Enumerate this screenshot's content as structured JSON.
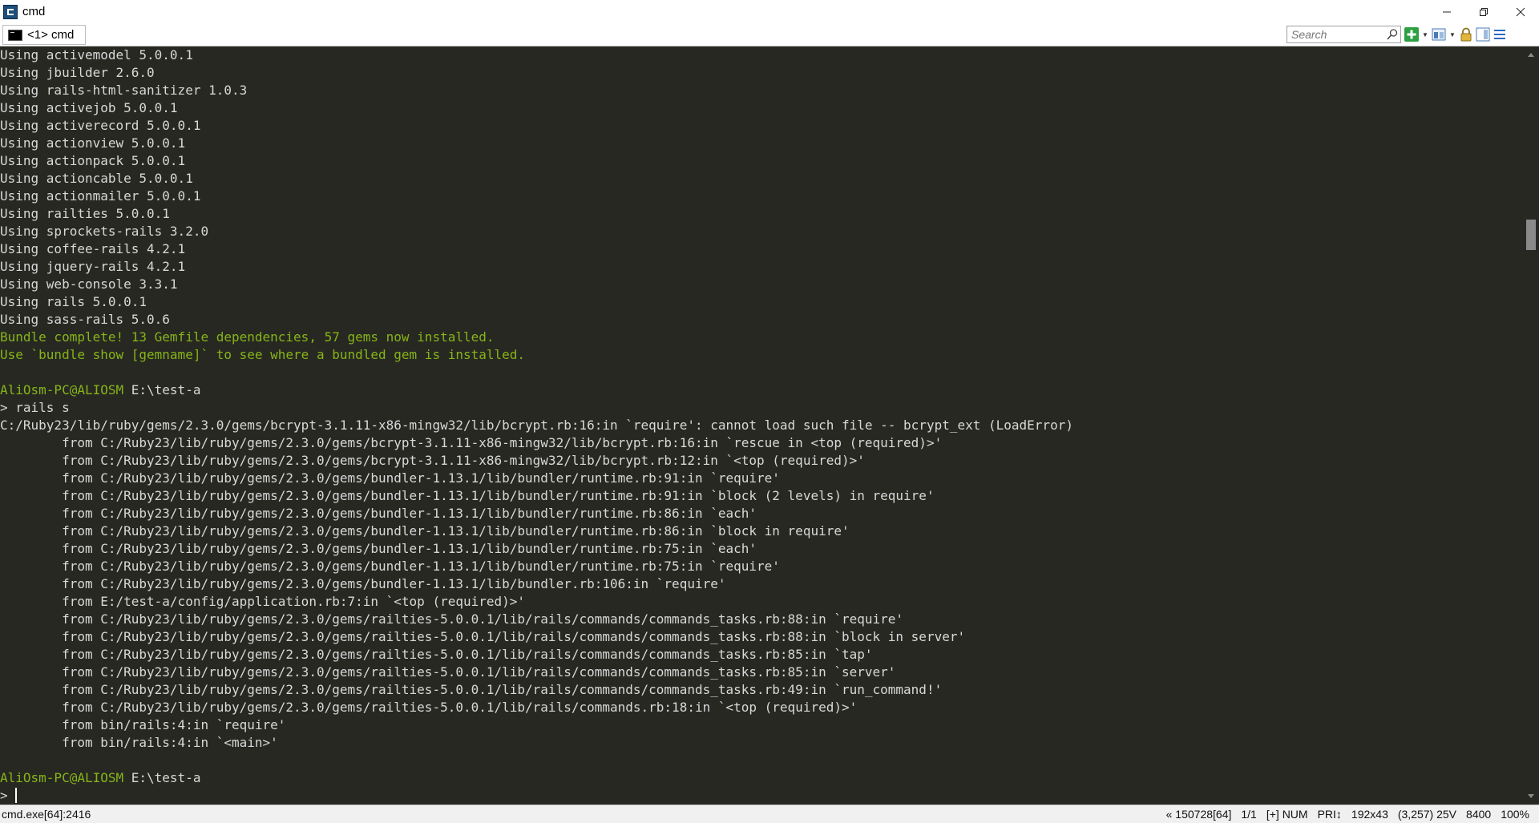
{
  "window": {
    "title": "cmd",
    "controls": {
      "minimize": "—",
      "restore": "❐",
      "close": "✕"
    }
  },
  "toolbar": {
    "tab_label": "<1> cmd",
    "search_placeholder": "Search"
  },
  "console": {
    "lines": [
      {
        "text": "Using activemodel 5.0.0.1",
        "style": "normal"
      },
      {
        "text": "Using jbuilder 2.6.0",
        "style": "normal"
      },
      {
        "text": "Using rails-html-sanitizer 1.0.3",
        "style": "normal"
      },
      {
        "text": "Using activejob 5.0.0.1",
        "style": "normal"
      },
      {
        "text": "Using activerecord 5.0.0.1",
        "style": "normal"
      },
      {
        "text": "Using actionview 5.0.0.1",
        "style": "normal"
      },
      {
        "text": "Using actionpack 5.0.0.1",
        "style": "normal"
      },
      {
        "text": "Using actioncable 5.0.0.1",
        "style": "normal"
      },
      {
        "text": "Using actionmailer 5.0.0.1",
        "style": "normal"
      },
      {
        "text": "Using railties 5.0.0.1",
        "style": "normal"
      },
      {
        "text": "Using sprockets-rails 3.2.0",
        "style": "normal"
      },
      {
        "text": "Using coffee-rails 4.2.1",
        "style": "normal"
      },
      {
        "text": "Using jquery-rails 4.2.1",
        "style": "normal"
      },
      {
        "text": "Using web-console 3.3.1",
        "style": "normal"
      },
      {
        "text": "Using rails 5.0.0.1",
        "style": "normal"
      },
      {
        "text": "Using sass-rails 5.0.6",
        "style": "normal"
      },
      {
        "text": "Bundle complete! 13 Gemfile dependencies, 57 gems now installed.",
        "style": "green"
      },
      {
        "text": "Use `bundle show [gemname]` to see where a bundled gem is installed.",
        "style": "green"
      },
      {
        "text": "",
        "style": "normal"
      },
      {
        "text": "AliOsm-PC@ALIOSM E:\\test-a",
        "style": "prompt"
      },
      {
        "text": "> rails s",
        "style": "normal"
      },
      {
        "text": "C:/Ruby23/lib/ruby/gems/2.3.0/gems/bcrypt-3.1.11-x86-mingw32/lib/bcrypt.rb:16:in `require': cannot load such file -- bcrypt_ext (LoadError)",
        "style": "normal"
      },
      {
        "text": "        from C:/Ruby23/lib/ruby/gems/2.3.0/gems/bcrypt-3.1.11-x86-mingw32/lib/bcrypt.rb:16:in `rescue in <top (required)>'",
        "style": "normal"
      },
      {
        "text": "        from C:/Ruby23/lib/ruby/gems/2.3.0/gems/bcrypt-3.1.11-x86-mingw32/lib/bcrypt.rb:12:in `<top (required)>'",
        "style": "normal"
      },
      {
        "text": "        from C:/Ruby23/lib/ruby/gems/2.3.0/gems/bundler-1.13.1/lib/bundler/runtime.rb:91:in `require'",
        "style": "normal"
      },
      {
        "text": "        from C:/Ruby23/lib/ruby/gems/2.3.0/gems/bundler-1.13.1/lib/bundler/runtime.rb:91:in `block (2 levels) in require'",
        "style": "normal"
      },
      {
        "text": "        from C:/Ruby23/lib/ruby/gems/2.3.0/gems/bundler-1.13.1/lib/bundler/runtime.rb:86:in `each'",
        "style": "normal"
      },
      {
        "text": "        from C:/Ruby23/lib/ruby/gems/2.3.0/gems/bundler-1.13.1/lib/bundler/runtime.rb:86:in `block in require'",
        "style": "normal"
      },
      {
        "text": "        from C:/Ruby23/lib/ruby/gems/2.3.0/gems/bundler-1.13.1/lib/bundler/runtime.rb:75:in `each'",
        "style": "normal"
      },
      {
        "text": "        from C:/Ruby23/lib/ruby/gems/2.3.0/gems/bundler-1.13.1/lib/bundler/runtime.rb:75:in `require'",
        "style": "normal"
      },
      {
        "text": "        from C:/Ruby23/lib/ruby/gems/2.3.0/gems/bundler-1.13.1/lib/bundler.rb:106:in `require'",
        "style": "normal"
      },
      {
        "text": "        from E:/test-a/config/application.rb:7:in `<top (required)>'",
        "style": "normal"
      },
      {
        "text": "        from C:/Ruby23/lib/ruby/gems/2.3.0/gems/railties-5.0.0.1/lib/rails/commands/commands_tasks.rb:88:in `require'",
        "style": "normal"
      },
      {
        "text": "        from C:/Ruby23/lib/ruby/gems/2.3.0/gems/railties-5.0.0.1/lib/rails/commands/commands_tasks.rb:88:in `block in server'",
        "style": "normal"
      },
      {
        "text": "        from C:/Ruby23/lib/ruby/gems/2.3.0/gems/railties-5.0.0.1/lib/rails/commands/commands_tasks.rb:85:in `tap'",
        "style": "normal"
      },
      {
        "text": "        from C:/Ruby23/lib/ruby/gems/2.3.0/gems/railties-5.0.0.1/lib/rails/commands/commands_tasks.rb:85:in `server'",
        "style": "normal"
      },
      {
        "text": "        from C:/Ruby23/lib/ruby/gems/2.3.0/gems/railties-5.0.0.1/lib/rails/commands/commands_tasks.rb:49:in `run_command!'",
        "style": "normal"
      },
      {
        "text": "        from C:/Ruby23/lib/ruby/gems/2.3.0/gems/railties-5.0.0.1/lib/rails/commands.rb:18:in `<top (required)>'",
        "style": "normal"
      },
      {
        "text": "        from bin/rails:4:in `require'",
        "style": "normal"
      },
      {
        "text": "        from bin/rails:4:in `<main>'",
        "style": "normal"
      },
      {
        "text": "",
        "style": "normal"
      },
      {
        "text": "AliOsm-PC@ALIOSM E:\\test-a",
        "style": "prompt"
      },
      {
        "text": "> ",
        "style": "input"
      }
    ]
  },
  "statusbar": {
    "process": "cmd.exe[64]:2416",
    "items": [
      "« 150728[64]",
      "1/1",
      "[+] NUM",
      "PRI↕",
      "192x43",
      "(3,257) 25V",
      "8400",
      "100%"
    ]
  },
  "colors": {
    "console_bg": "#272822",
    "console_fg": "#d8d8d8",
    "accent_green": "#86b418"
  }
}
